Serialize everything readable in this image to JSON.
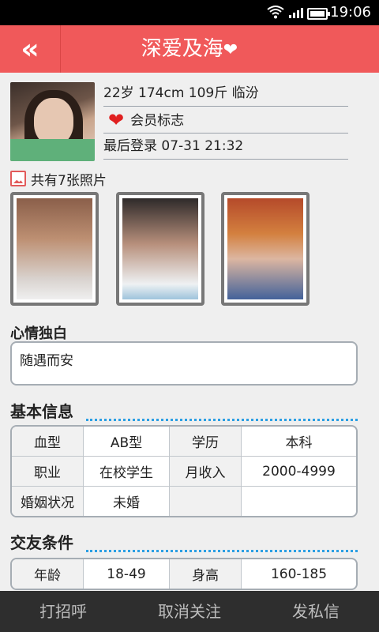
{
  "status": {
    "time": "19:06"
  },
  "header": {
    "title": "深爱及海",
    "title_heart": "❤",
    "back_glyph": "«"
  },
  "profile": {
    "line1": "22岁  174cm  109斤  临汾",
    "member_heart": "❤",
    "member_label": "会员标志",
    "last_login": "最后登录  07-31 21:32"
  },
  "photos": {
    "heading": "共有7张照片"
  },
  "mood": {
    "label": "心情独白",
    "text": "随遇而安"
  },
  "basic": {
    "label": "基本信息",
    "rows": [
      [
        "血型",
        "AB型",
        "学历",
        "本科"
      ],
      [
        "职业",
        "在校学生",
        "月收入",
        "2000-4999"
      ],
      [
        "婚姻状况",
        "未婚",
        "",
        ""
      ]
    ]
  },
  "friend": {
    "label": "交友条件",
    "rows": [
      [
        "年龄",
        "18-49",
        "身高",
        "160-185"
      ]
    ]
  },
  "actions": {
    "greet": "打招呼",
    "unfollow": "取消关注",
    "message": "发私信"
  },
  "colors": {
    "titlebar": "#f0595a",
    "accent_blue": "#2b9fe4",
    "bottom_bar": "#2e2e2e"
  }
}
